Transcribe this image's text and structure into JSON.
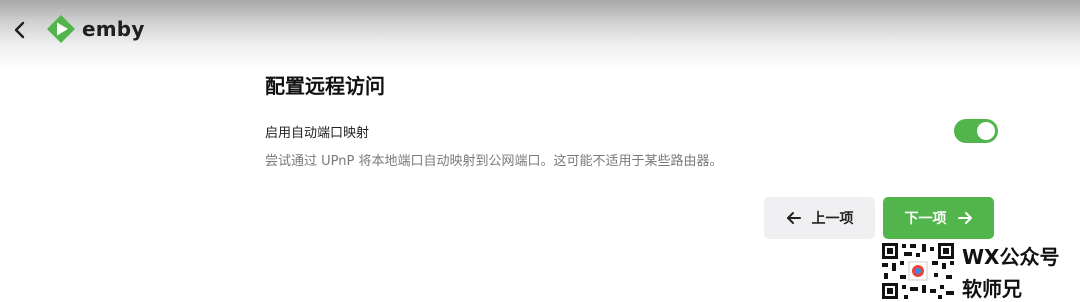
{
  "header": {
    "logo_text": "emby",
    "back_icon": "chevron-left-icon",
    "logo_icon": "emby-play-icon",
    "brand_color": "#52b54b"
  },
  "main": {
    "title": "配置远程访问",
    "setting": {
      "label": "启用自动端口映射",
      "description": "尝试通过 UPnP 将本地端口自动映射到公网端口。这可能不适用于某些路由器。",
      "enabled": true
    }
  },
  "actions": {
    "prev_label": "上一项",
    "next_label": "下一项",
    "prev_icon": "arrow-left-icon",
    "next_icon": "arrow-right-icon"
  },
  "watermark": {
    "line1": "WX公众号",
    "line2": "软师兄"
  }
}
